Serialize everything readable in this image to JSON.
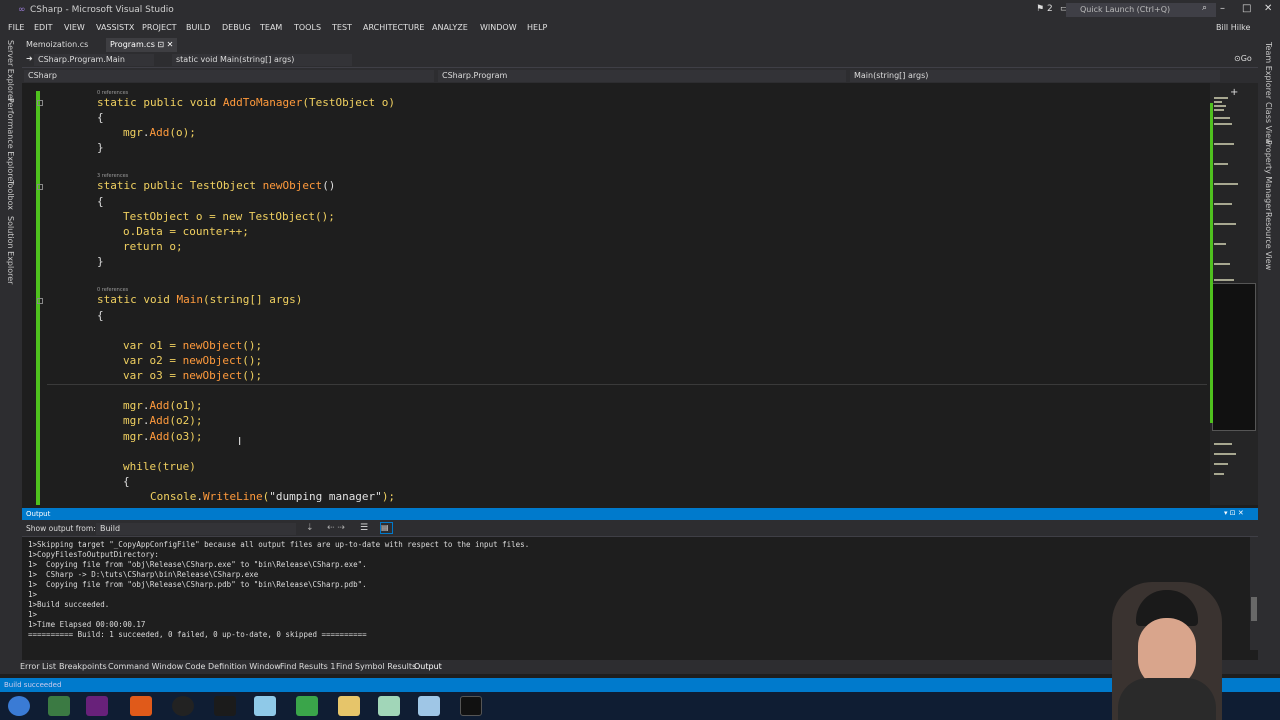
{
  "window": {
    "title": "CSharp - Microsoft Visual Studio",
    "quick_launch": "Quick Launch (Ctrl+Q)",
    "notifications": "2",
    "user": "Bill Hilke"
  },
  "menu": [
    "FILE",
    "EDIT",
    "VIEW",
    "VASSISTX",
    "PROJECT",
    "BUILD",
    "DEBUG",
    "TEAM",
    "TOOLS",
    "TEST",
    "ARCHITECTURE",
    "ANALYZE",
    "WINDOW",
    "HELP"
  ],
  "left_panels": [
    "Server Explorer",
    "Performance Explorer",
    "Toolbox",
    "Solution Explorer"
  ],
  "right_panels": [
    "Team Explorer",
    "Class View",
    "Property Manager",
    "Resource View"
  ],
  "tabs": [
    {
      "label": "Memoization.cs"
    },
    {
      "label": "Program.cs"
    }
  ],
  "nav": {
    "member": "CSharp.Program.Main",
    "method": "static void Main(string[] args)",
    "go": "Go",
    "project": "CSharp",
    "class": "CSharp.Program",
    "signature": "Main(string[] args)"
  },
  "refs": {
    "r0": "0 references",
    "r3": "3 references"
  },
  "code": [
    "static public void AddToManager(TestObject o)",
    "{",
    "mgr.Add(o);",
    "}",
    "static public TestObject newObject()",
    "{",
    "TestObject o = new TestObject();",
    "o.Data = counter++;",
    "return o;",
    "}",
    "static void Main(string[] args)",
    "{",
    "var o1 = newObject();",
    "var o2 = newObject();",
    "var o3 = newObject();",
    "mgr.Add(o1);",
    "mgr.Add(o2);",
    "mgr.Add(o3);",
    "while(true)",
    "{",
    "Console.WriteLine(\"dumping manager\");"
  ],
  "output": {
    "title": "Output",
    "show_from_label": "Show output from:",
    "source": "Build",
    "lines": [
      "1>Skipping target \"_CopyAppConfigFile\" because all output files are up-to-date with respect to the input files.",
      "1>CopyFilesToOutputDirectory:",
      "1>  Copying file from \"obj\\Release\\CSharp.exe\" to \"bin\\Release\\CSharp.exe\".",
      "1>  CSharp -> D:\\tuts\\CSharp\\bin\\Release\\CSharp.exe",
      "1>  Copying file from \"obj\\Release\\CSharp.pdb\" to \"bin\\Release\\CSharp.pdb\".",
      "1>",
      "1>Build succeeded.",
      "1>",
      "1>Time Elapsed 00:00:00.17",
      "========== Build: 1 succeeded, 0 failed, 0 up-to-date, 0 skipped =========="
    ]
  },
  "bottom_tabs": [
    "Error List",
    "Breakpoints",
    "Command Window",
    "Code Definition Window",
    "Find Results 1",
    "Find Symbol Results",
    "Output"
  ],
  "status": "Build succeeded",
  "colors": {
    "accent": "#007acc",
    "keyword": "#f0d060",
    "method": "#ff9a3c",
    "change_bar": "#4fc11e"
  }
}
